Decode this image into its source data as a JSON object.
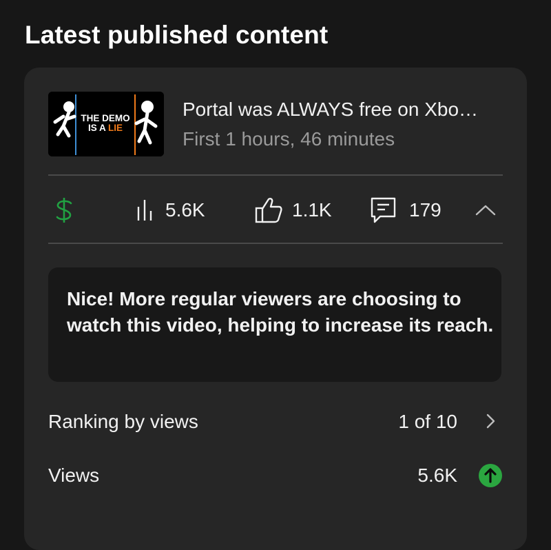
{
  "header": {
    "title": "Latest published content"
  },
  "video": {
    "thumbnail_text_line1": "THE DEMO",
    "thumbnail_text_line2_a": "IS A ",
    "thumbnail_text_line2_b": "LIE",
    "title": "Portal was ALWAYS free on Xbo…",
    "subtitle": "First 1 hours, 46 minutes"
  },
  "stats": {
    "monetization_icon": "dollar-icon",
    "views_icon": "bar-chart-icon",
    "views": "5.6K",
    "likes_icon": "thumbs-up-icon",
    "likes": "1.1K",
    "comments_icon": "comment-icon",
    "comments": "179",
    "collapse_icon": "chevron-up-icon"
  },
  "callout": {
    "text": "Nice! More regular viewers are choosing to watch this video, helping to increase its reach."
  },
  "metrics": [
    {
      "label": "Ranking by views",
      "value": "1 of 10",
      "icon": "chevron-right-icon"
    },
    {
      "label": "Views",
      "value": "5.6K",
      "icon": "arrow-up-circle-icon"
    }
  ],
  "colors": {
    "background": "#171717",
    "card": "#262626",
    "callout": "#181818",
    "money_green": "#21a142",
    "trend_green": "#2ba640",
    "portal_blue": "#3f8fd6",
    "portal_orange": "#f07a1a"
  }
}
